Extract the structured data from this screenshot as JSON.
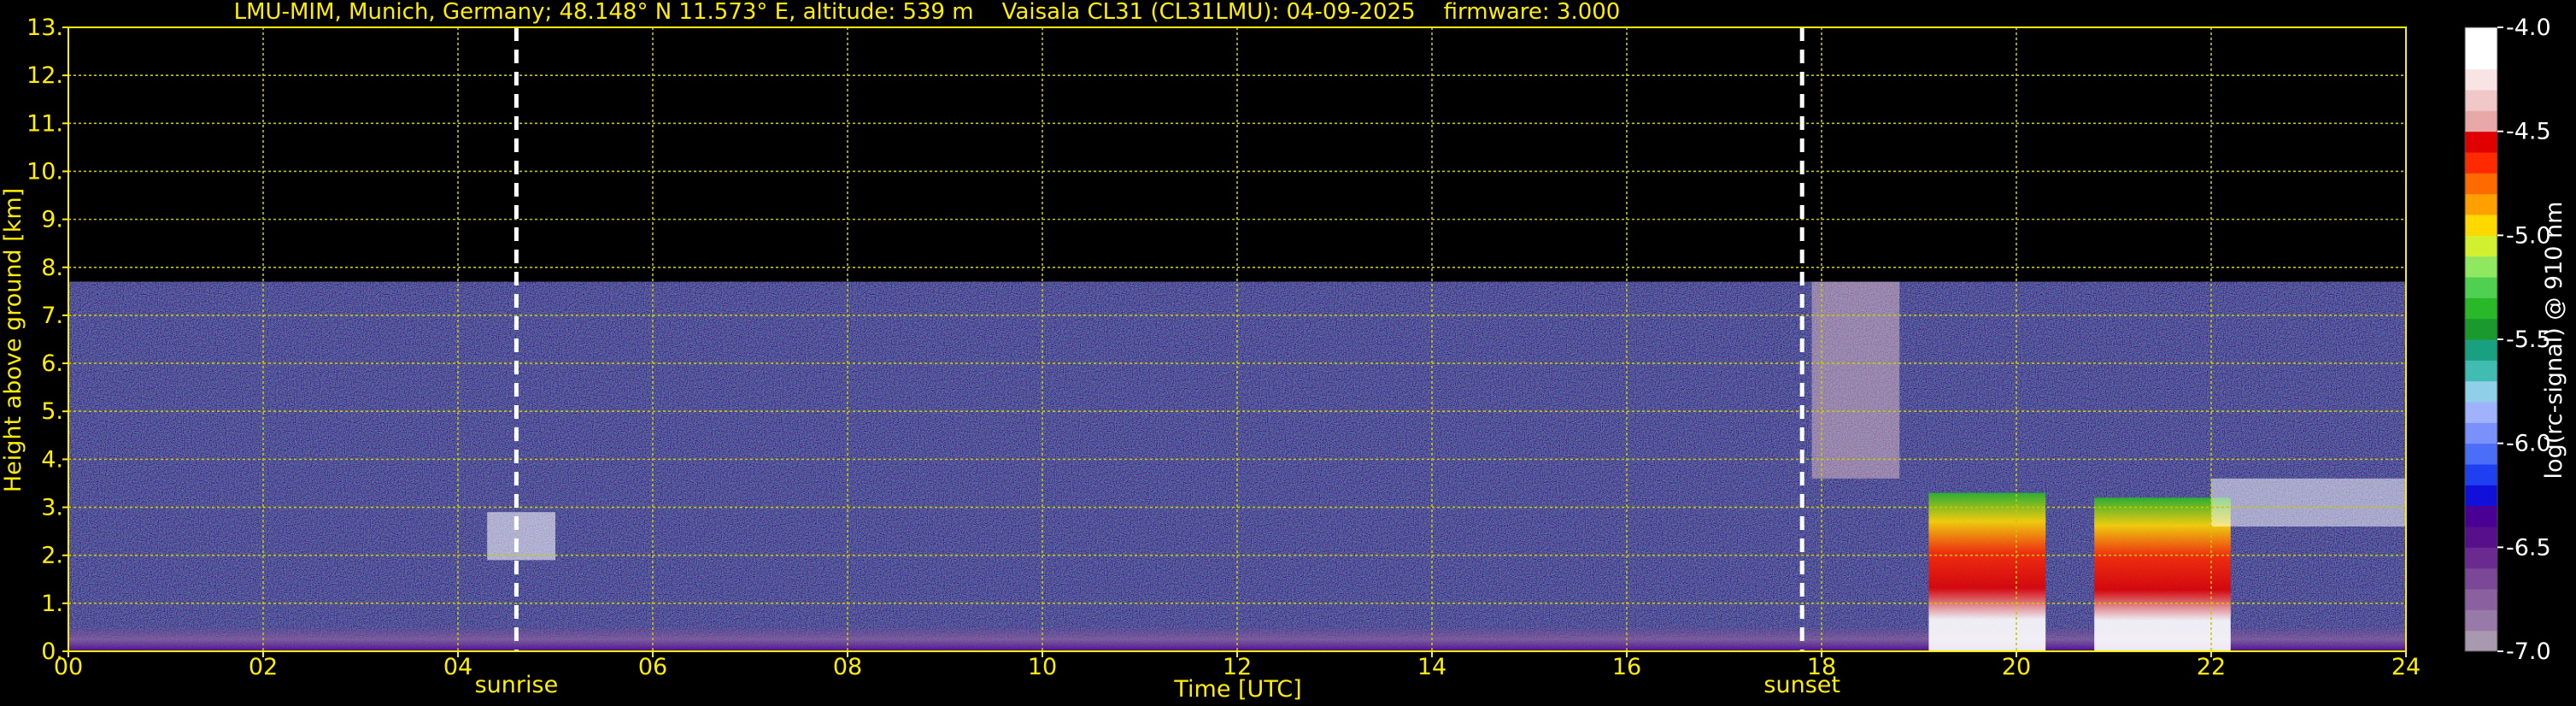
{
  "chart_data": {
    "type": "heatmap",
    "title": "LMU-MIM, Munich, Germany; 48.148° N 11.573° E, altitude: 539 m    Vaisala CL31 (CL31LMU): 04-09-2025    firmware: 3.000",
    "xlabel": "Time [UTC]",
    "ylabel": "Height above ground [km]",
    "xlim": [
      0,
      24
    ],
    "ylim": [
      0,
      13
    ],
    "x_ticks": [
      0,
      2,
      4,
      6,
      8,
      10,
      12,
      14,
      16,
      18,
      20,
      22,
      24
    ],
    "x_tick_labels": [
      "00",
      "02",
      "04",
      "06",
      "08",
      "10",
      "12",
      "14",
      "16",
      "18",
      "20",
      "22",
      "24"
    ],
    "y_ticks": [
      0,
      1,
      2,
      3,
      4,
      5,
      6,
      7,
      8,
      9,
      10,
      11,
      12,
      13
    ],
    "y_tick_labels": [
      "0.",
      "1.",
      "2.",
      "3.",
      "4.",
      "5.",
      "6.",
      "7.",
      "8.",
      "9.",
      "10.",
      "11.",
      "12.",
      "13."
    ],
    "grid": true,
    "data_top_km": 7.7,
    "events": [
      {
        "label": "sunrise",
        "time": 4.6
      },
      {
        "label": "sunset",
        "time": 17.8
      }
    ],
    "colorbar": {
      "label": "log(rc-signal) @ 910 nm",
      "range": [
        -7.0,
        -4.0
      ],
      "tick_values": [
        -7.0,
        -6.5,
        -6.0,
        -5.5,
        -5.0,
        -4.5,
        -4.0
      ],
      "tick_labels": [
        "-7.0",
        "-6.5",
        "-6.0",
        "-5.5",
        "-5.0",
        "-4.5",
        "-4.0"
      ],
      "colors": [
        "#a898b0",
        "#987aa8",
        "#8a609e",
        "#7a4896",
        "#6a2a90",
        "#55108a",
        "#4a0094",
        "#1010d8",
        "#1e40f0",
        "#4a6ef8",
        "#7a90fa",
        "#a0b2fc",
        "#8fd0e8",
        "#40bcb0",
        "#18a080",
        "#1a9a2c",
        "#28b828",
        "#50d050",
        "#90e860",
        "#d0f030",
        "#ffd800",
        "#ffa000",
        "#ff6a00",
        "#ff2a00",
        "#e00000",
        "#e8a8a8",
        "#f0c8c8",
        "#f8e4e4",
        "#ffffff",
        "#ffffff"
      ]
    },
    "features": [
      {
        "name": "boundary layer aerosol",
        "t_start": 0,
        "t_end": 24,
        "h_bottom": 0,
        "h_top": 0.5
      },
      {
        "name": "cloud near sunrise",
        "t_start": 4.3,
        "t_end": 5.0,
        "h_bottom": 1.9,
        "h_top": 2.9
      },
      {
        "name": "high cloud after sunset",
        "t_start": 17.9,
        "t_end": 18.8,
        "h_bottom": 3.6,
        "h_top": 7.7
      },
      {
        "name": "low cloud",
        "t_start": 19.1,
        "t_end": 20.3,
        "h_bottom": 0,
        "h_top": 3.3
      },
      {
        "name": "low cloud",
        "t_start": 20.8,
        "t_end": 22.2,
        "h_bottom": 0,
        "h_top": 3.2
      },
      {
        "name": "cloud layer",
        "t_start": 22.0,
        "t_end": 24,
        "h_bottom": 2.6,
        "h_top": 3.6
      }
    ]
  }
}
